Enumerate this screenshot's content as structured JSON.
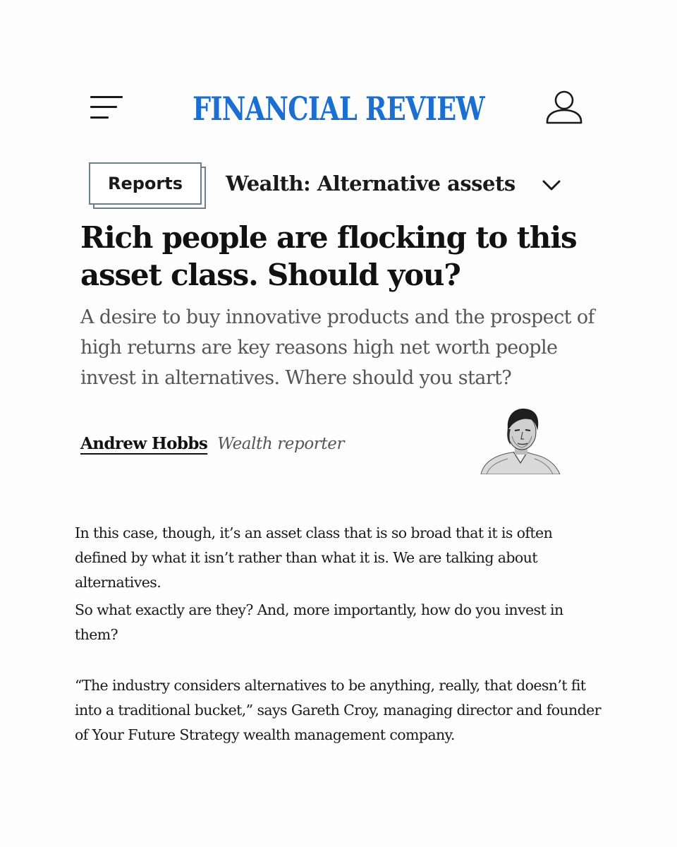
{
  "header": {
    "logo_text": "FINANCIAL REVIEW",
    "menu_icon": "hamburger-menu-icon",
    "user_icon": "user-account-icon",
    "logo_color": "#1b6fd0"
  },
  "section": {
    "badge_label": "Reports",
    "title": "Wealth: Alternative assets",
    "expand_icon": "chevron-down-icon"
  },
  "article": {
    "headline": "Rich people are flocking to this asset class. Should you?",
    "standfirst": "A desire to buy innovative products and the prospect of high returns are key reasons high net worth people invest in alternatives. Where should you start?",
    "author": {
      "name": "Andrew Hobbs",
      "role": "Wealth reporter"
    },
    "paragraphs": [
      "In this case, though, it’s an asset class that is so broad that it is often defined by what it isn’t rather than what it is. We are talking about alternatives.",
      "So what exactly are they? And, more importantly, how do you invest in them?",
      "“The industry considers alternatives to be anything, really, that doesn’t fit into a traditional bucket,” says Gareth Croy, managing director and founder of Your Future Strategy wealth management company."
    ]
  }
}
